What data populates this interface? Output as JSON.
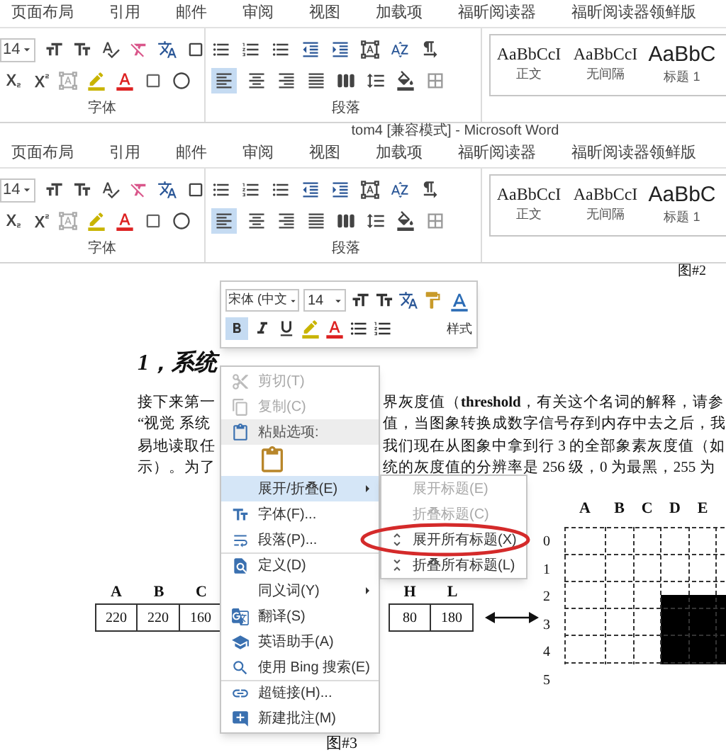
{
  "ribbon_1": {
    "tabs": [
      "页面布局",
      "引用",
      "邮件",
      "审阅",
      "视图",
      "加载项",
      "福昕阅读器",
      "福昕阅读器领鲜版"
    ],
    "font_size": "14",
    "align_left_selected": true,
    "styles": [
      {
        "sample": "AaBbCcI",
        "label": "正文",
        "kind": "body"
      },
      {
        "sample": "AaBbCcI",
        "label": "无间隔",
        "kind": "body"
      },
      {
        "sample": "AaBbC",
        "label": "标题 1",
        "kind": "heading"
      }
    ],
    "groups": [
      "字体",
      "段落"
    ]
  },
  "title_bar": {
    "title": "tom4 [兼容模式] - Microsoft Word"
  },
  "ribbon_2": {
    "tabs": [
      "页面布局",
      "引用",
      "邮件",
      "审阅",
      "视图",
      "加载项",
      "福昕阅读器",
      "福昕阅读器领鲜版"
    ],
    "font_size": "14",
    "align_left_selected": true,
    "styles": [
      {
        "sample": "AaBbCcI",
        "label": "正文",
        "kind": "body"
      },
      {
        "sample": "AaBbCcI",
        "label": "无间隔",
        "kind": "body"
      },
      {
        "sample": "AaBbC",
        "label": "标题 1",
        "kind": "heading"
      }
    ],
    "groups": [
      "字体",
      "段落"
    ]
  },
  "document": {
    "top_caption": "图#2",
    "heading": "1，系统",
    "lines": [
      {
        "left": "接下来第一",
        "right": "界灰度值（**threshold**，有关这个名词的解释，请参"
      },
      {
        "left": "“视觉 系统",
        "right": "值，当图象转换成数字信号存到内存中去之后，我"
      },
      {
        "left": "易地读取任",
        "right": "我们现在从图象中拿到行 3 的全部象素灰度值（如"
      },
      {
        "left": "示）。为了",
        "right": "统的灰度值的分辨率是 256 级，0 为最黑，255 为"
      }
    ],
    "figure": {
      "left_cells": [
        {
          "label": "A",
          "value": "220"
        },
        {
          "label": "B",
          "value": "220"
        },
        {
          "label": "C",
          "value": "160"
        }
      ],
      "right_cells": [
        {
          "label": "H",
          "value": "80"
        },
        {
          "label": "L",
          "value": "180"
        }
      ],
      "grid_columns": [
        "A",
        "B",
        "C",
        "D",
        "E"
      ],
      "grid_rows": [
        "0",
        "1",
        "2",
        "3",
        "4",
        "5"
      ]
    },
    "bottom_caption": "图#3"
  },
  "mini_toolbar": {
    "font_name": "宋体 (中文",
    "font_size": "14",
    "styles_label": "样式",
    "bold_active": true
  },
  "context_menu": {
    "items": [
      {
        "kind": "item",
        "label": "剪切(T)",
        "disabled": true,
        "submenu": false,
        "selected": false,
        "separator_before": false
      },
      {
        "kind": "item",
        "label": "复制(C)",
        "disabled": true,
        "submenu": false,
        "selected": false,
        "separator_before": false
      },
      {
        "kind": "header",
        "label": "粘贴选项:",
        "disabled": false,
        "submenu": false,
        "selected": false,
        "separator_before": false
      },
      {
        "kind": "paste_options",
        "disabled": false,
        "submenu": false,
        "selected": false,
        "separator_before": false
      },
      {
        "kind": "item",
        "label": "展开/折叠(E)",
        "disabled": false,
        "submenu": true,
        "selected": true,
        "separator_before": false
      },
      {
        "kind": "item",
        "label": "字体(F)...",
        "disabled": false,
        "submenu": false,
        "selected": false,
        "separator_before": false
      },
      {
        "kind": "item",
        "label": "段落(P)...",
        "disabled": false,
        "submenu": false,
        "selected": false,
        "separator_before": false
      },
      {
        "kind": "item",
        "label": "定义(D)",
        "disabled": false,
        "submenu": false,
        "selected": false,
        "separator_before": true
      },
      {
        "kind": "item",
        "label": "同义词(Y)",
        "disabled": false,
        "submenu": true,
        "selected": false,
        "separator_before": false
      },
      {
        "kind": "item",
        "label": "翻译(S)",
        "disabled": false,
        "submenu": false,
        "selected": false,
        "separator_before": false
      },
      {
        "kind": "item",
        "label": "英语助手(A)",
        "disabled": false,
        "submenu": false,
        "selected": false,
        "separator_before": false
      },
      {
        "kind": "item",
        "label": "使用 Bing 搜索(E)",
        "disabled": false,
        "submenu": false,
        "selected": false,
        "separator_before": false
      },
      {
        "kind": "item",
        "label": "超链接(H)...",
        "disabled": false,
        "submenu": false,
        "selected": false,
        "separator_before": true
      },
      {
        "kind": "item",
        "label": "新建批注(M)",
        "disabled": false,
        "submenu": false,
        "selected": false,
        "separator_before": false
      }
    ]
  },
  "submenu": {
    "items": [
      {
        "label": "展开标题(E)",
        "disabled": true
      },
      {
        "label": "折叠标题(C)",
        "disabled": true
      },
      {
        "label": "展开所有标题(X)",
        "disabled": false
      },
      {
        "label": "折叠所有标题(L)",
        "disabled": false
      }
    ]
  },
  "annotation": {
    "kind": "ellipse"
  }
}
